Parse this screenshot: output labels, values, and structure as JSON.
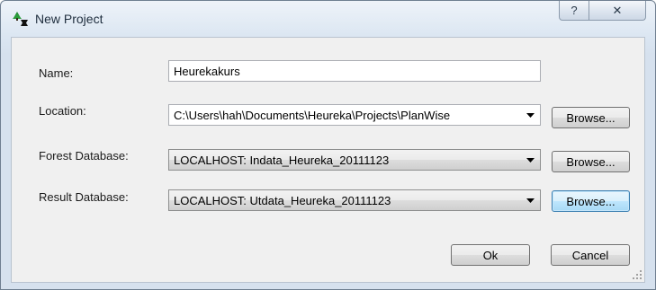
{
  "window": {
    "title": "New Project",
    "help_glyph": "?",
    "close_glyph": "✕"
  },
  "form": {
    "name": {
      "label": "Name:",
      "value": "Heurekakurs"
    },
    "location": {
      "label": "Location:",
      "value": "C:\\Users\\hah\\Documents\\Heureka\\Projects\\PlanWise",
      "browse_label": "Browse..."
    },
    "forest_db": {
      "label": "Forest Database:",
      "value": "LOCALHOST: Indata_Heureka_20111123",
      "browse_label": "Browse..."
    },
    "result_db": {
      "label": "Result Database:",
      "value": "LOCALHOST: Utdata_Heureka_20111123",
      "browse_label": "Browse..."
    }
  },
  "actions": {
    "ok_label": "Ok",
    "cancel_label": "Cancel"
  },
  "colors": {
    "focus_border": "#3c7fb1",
    "app_icon_green": "#1f8a2e"
  }
}
